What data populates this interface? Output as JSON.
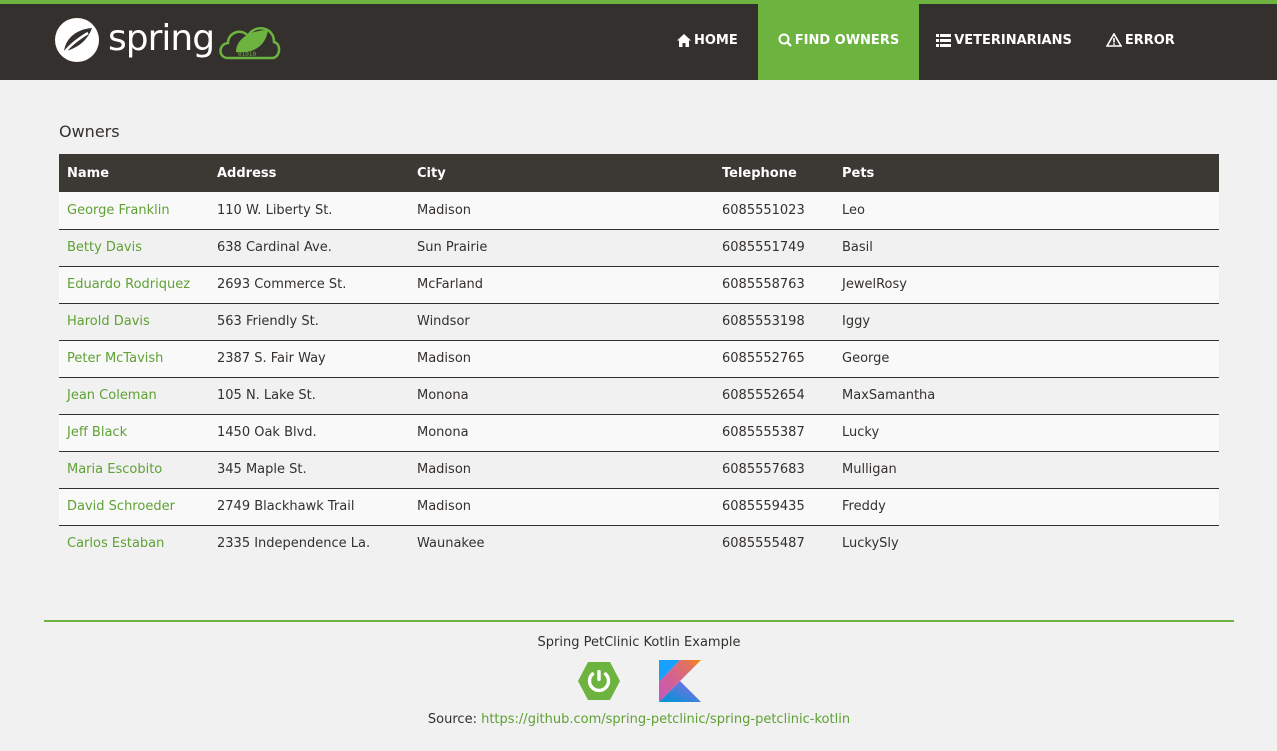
{
  "header": {
    "brand": "spring",
    "brand_badge": "01010",
    "accent_color": "#6db33f",
    "nav": [
      {
        "label": "Home",
        "icon": "home-icon",
        "active": false
      },
      {
        "label": "Find owners",
        "icon": "search-icon",
        "active": true
      },
      {
        "label": "Veterinarians",
        "icon": "list-icon",
        "active": false
      },
      {
        "label": "Error",
        "icon": "warning-icon",
        "active": false
      }
    ]
  },
  "main": {
    "title": "Owners",
    "columns": [
      "Name",
      "Address",
      "City",
      "Telephone",
      "Pets"
    ],
    "rows": [
      {
        "name": "George Franklin",
        "address": "110 W. Liberty St.",
        "city": "Madison",
        "telephone": "6085551023",
        "pets": "Leo"
      },
      {
        "name": "Betty Davis",
        "address": "638 Cardinal Ave.",
        "city": "Sun Prairie",
        "telephone": "6085551749",
        "pets": "Basil"
      },
      {
        "name": "Eduardo Rodriquez",
        "address": "2693 Commerce St.",
        "city": "McFarland",
        "telephone": "6085558763",
        "pets": "JewelRosy"
      },
      {
        "name": "Harold Davis",
        "address": "563 Friendly St.",
        "city": "Windsor",
        "telephone": "6085553198",
        "pets": "Iggy"
      },
      {
        "name": "Peter McTavish",
        "address": "2387 S. Fair Way",
        "city": "Madison",
        "telephone": "6085552765",
        "pets": "George"
      },
      {
        "name": "Jean Coleman",
        "address": "105 N. Lake St.",
        "city": "Monona",
        "telephone": "6085552654",
        "pets": "MaxSamantha"
      },
      {
        "name": "Jeff Black",
        "address": "1450 Oak Blvd.",
        "city": "Monona",
        "telephone": "6085555387",
        "pets": "Lucky"
      },
      {
        "name": "Maria Escobito",
        "address": "345 Maple St.",
        "city": "Madison",
        "telephone": "6085557683",
        "pets": "Mulligan"
      },
      {
        "name": "David Schroeder",
        "address": "2749 Blackhawk Trail",
        "city": "Madison",
        "telephone": "6085559435",
        "pets": "Freddy"
      },
      {
        "name": "Carlos Estaban",
        "address": "2335 Independence La.",
        "city": "Waunakee",
        "telephone": "6085555487",
        "pets": "LuckySly"
      }
    ]
  },
  "footer": {
    "title": "Spring PetClinic Kotlin Example",
    "source_label": "Source: ",
    "source_link": "https://github.com/spring-petclinic/spring-petclinic-kotlin"
  }
}
